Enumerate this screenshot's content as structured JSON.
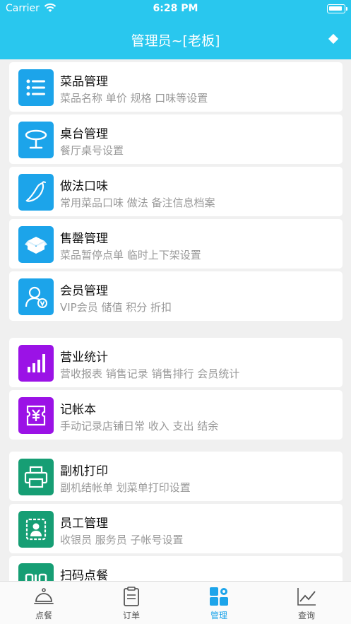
{
  "status_bar": {
    "carrier": "Carrier",
    "time": "6:28 PM"
  },
  "nav": {
    "title": "管理员~[老板]"
  },
  "menu": [
    {
      "title": "菜品管理",
      "desc": "菜品名称 单价 规格 口味等设置",
      "icon": "list-icon",
      "color": "#1ca4ea"
    },
    {
      "title": "桌台管理",
      "desc": "餐厅桌号设置",
      "icon": "table-icon",
      "color": "#1ca4ea"
    },
    {
      "title": "做法口味",
      "desc": "常用菜品口味 做法 备注信息档案",
      "icon": "pepper-icon",
      "color": "#1ca4ea"
    },
    {
      "title": "售罄管理",
      "desc": "菜品暂停点单 临时上下架设置",
      "icon": "box-icon",
      "color": "#1ca4ea"
    },
    {
      "title": "会员管理",
      "desc": "VIP会员 储值 积分 折扣",
      "icon": "vip-user-icon",
      "color": "#1ca4ea"
    },
    {
      "title": "营业统计",
      "desc": "营收报表 销售记录 销售排行 会员统计",
      "icon": "bar-chart-icon",
      "color": "#9b12e6"
    },
    {
      "title": "记帐本",
      "desc": "手动记录店铺日常 收入 支出 结余",
      "icon": "yen-ticket-icon",
      "color": "#9b12e6"
    },
    {
      "title": "副机打印",
      "desc": "副机结帐单 划菜单打印设置",
      "icon": "printer-icon",
      "color": "#169e74"
    },
    {
      "title": "员工管理",
      "desc": "收银员 服务员 子帐号设置",
      "icon": "staff-badge-icon",
      "color": "#169e74"
    },
    {
      "title": "扫码点餐",
      "desc": "",
      "icon": "qr-code-icon",
      "color": "#169e74"
    }
  ],
  "tabs": [
    {
      "label": "点餐",
      "icon": "cloche-icon",
      "active": false
    },
    {
      "label": "订单",
      "icon": "clipboard-icon",
      "active": false
    },
    {
      "label": "管理",
      "icon": "grid-gear-icon",
      "active": true
    },
    {
      "label": "查询",
      "icon": "line-chart-icon",
      "active": false
    }
  ]
}
